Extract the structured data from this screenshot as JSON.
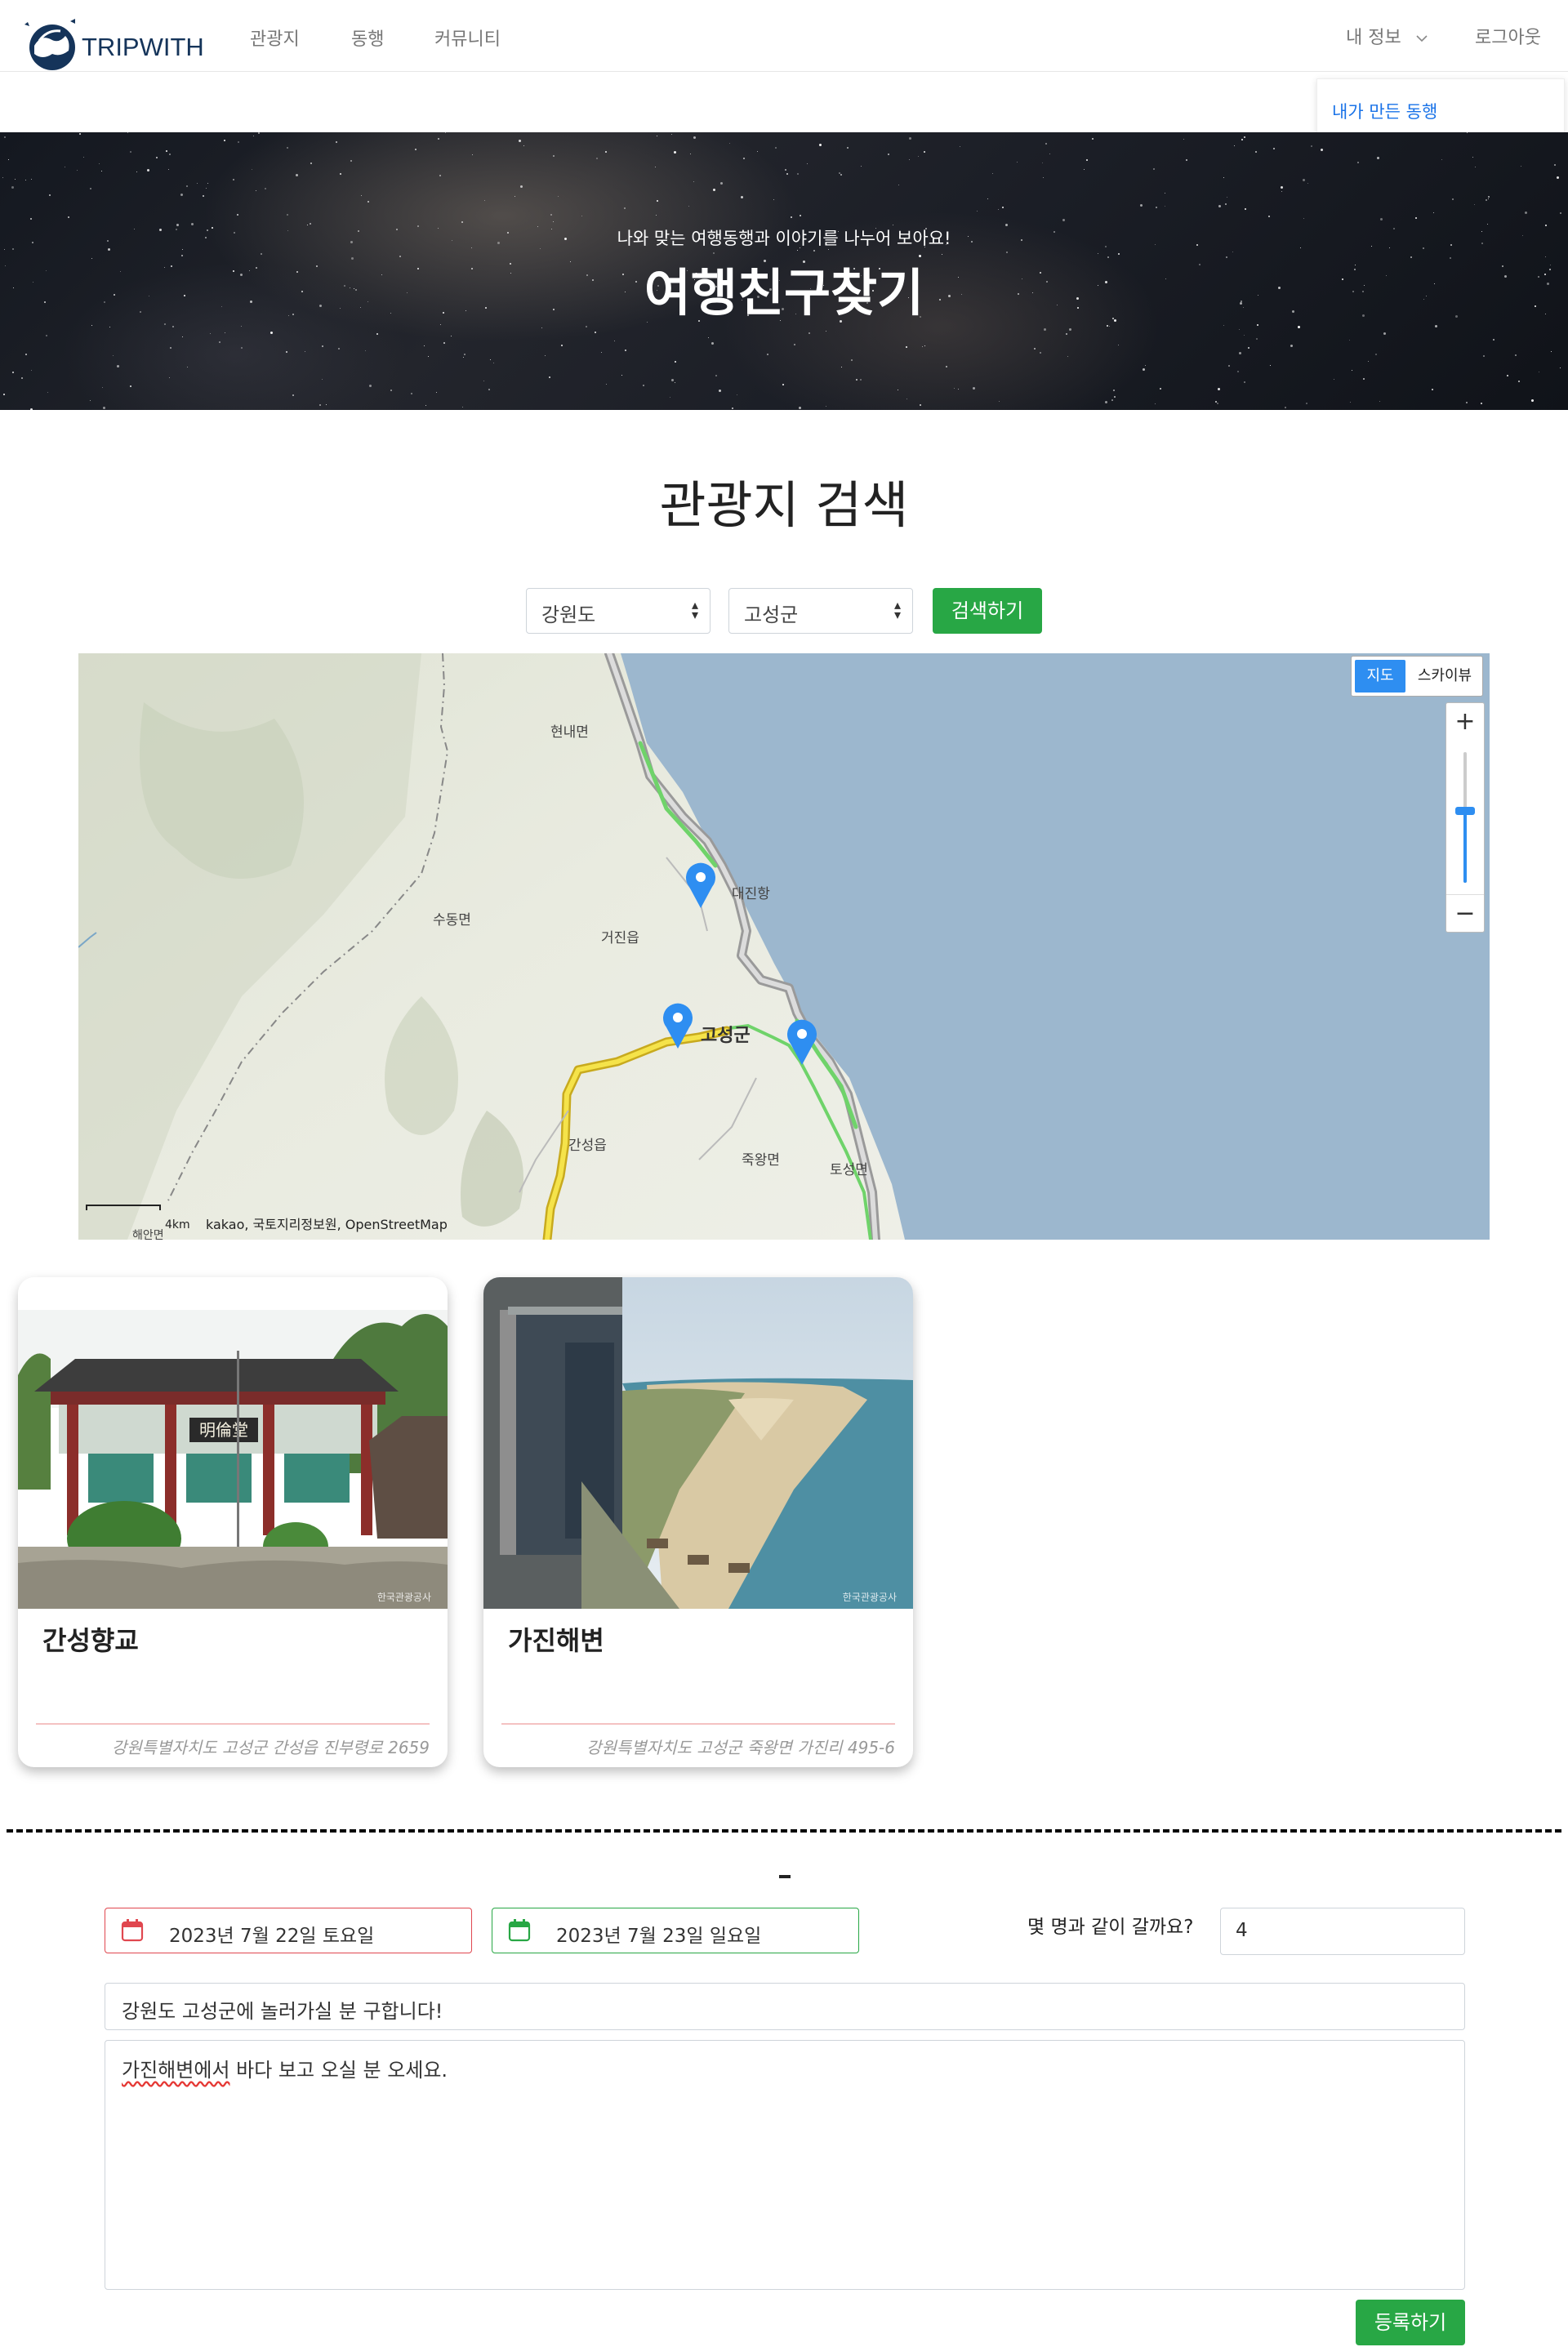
{
  "nav": {
    "logo_text": "TRIPWITH",
    "links": [
      "관광지",
      "동행",
      "커뮤니티"
    ],
    "my_info": "내 정보",
    "logout": "로그아웃",
    "dropdown_item": "내가 만든 동행"
  },
  "hero": {
    "subtitle": "나와 맞는 여행동행과 이야기를 나누어 보아요!",
    "title": "여행친구찾기"
  },
  "search": {
    "title": "관광지 검색",
    "province": "강원도",
    "district": "고성군",
    "button": "검색하기"
  },
  "map": {
    "type_map": "지도",
    "type_sky": "스카이뷰",
    "zoom_in": "+",
    "zoom_out": "−",
    "zoom_level_fraction": 0.55,
    "labels": [
      "현내면",
      "수동면",
      "거진읍",
      "간성읍",
      "죽왕면",
      "토성면",
      "대진항",
      "고성군"
    ],
    "scale": "4km",
    "credit": "kakao, 국토지리정보원, OpenStreetMap",
    "bottom_label": "해안면"
  },
  "cards": [
    {
      "title": "간성향교",
      "address": "강원특별자치도 고성군 간성읍 진부령로 2659",
      "watermark": "한국관광공사",
      "sign": "明倫堂"
    },
    {
      "title": "가진해변",
      "address": "강원특별자치도 고성군 죽왕면 가진리 495-6",
      "watermark": "한국관광공사"
    }
  ],
  "separator_mark": "-",
  "form": {
    "start_date": "2023년 7월 22일 토요일",
    "end_date": "2023년 7월 23일 일요일",
    "people_label": "몇 명과 같이 갈까요?",
    "people_value": "4",
    "title_value": "강원도 고성군에 놀러가실 분 구합니다!",
    "content_part1": "가진해변에서",
    "content_part2": " 바다 보고 오실 분 오세요.",
    "submit": "등록하기"
  },
  "colors": {
    "brand_navy": "#15345a",
    "green": "#28a745",
    "map_sea": "#9cb7ce",
    "map_blue": "#2e8ef1",
    "start_date_border": "#e0474f",
    "end_date_border": "#28a745"
  }
}
